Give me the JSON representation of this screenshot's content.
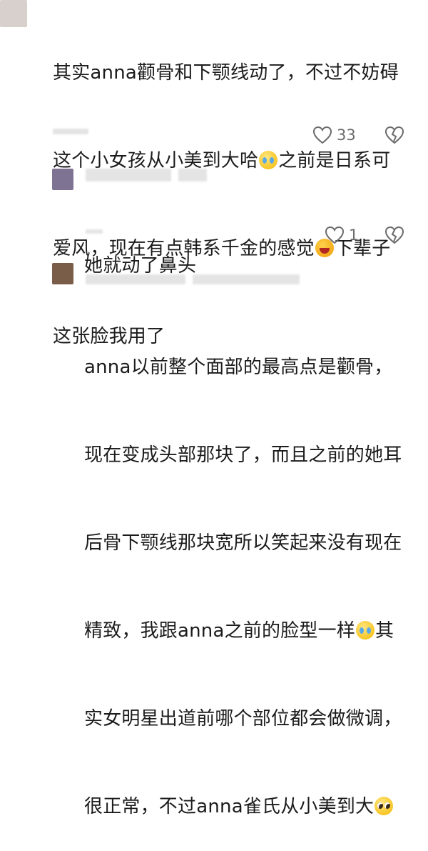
{
  "comments": [
    {
      "text_lines": [
        "其实anna颧骨和下颚线动了，不过不妨碍",
        "这个小女孩从小美到大哈",
        "之前是日系可",
        "爱风，现在有点韩系千金的感觉",
        "下辈子",
        "这张脸我用了"
      ],
      "emoji": [
        "crying-face",
        "laughing-crying-face"
      ],
      "likes": "33"
    },
    {
      "text_lines": [
        "她就动了鼻头"
      ],
      "likes": "1"
    },
    {
      "text_lines": [
        "anna以前整个面部的最高点是颧骨，",
        "现在变成头部那块了，而且之前的她耳",
        "后骨下颚线那块宽所以笑起来没有现在",
        "精致，我跟anna之前的脸型一样",
        "其",
        "实女明星出道前哪个部位都会做微调，",
        "很正常，不过anna雀氏从小美到大"
      ],
      "emoji": [
        "crying-face",
        "pleading-face"
      ]
    }
  ],
  "icons": {
    "like": "heart-outline-icon",
    "dislike": "broken-heart-icon"
  },
  "colors": {
    "text": "#1b1b1b",
    "meta": "#6b6b6b",
    "avatar1": "#d7d0cc",
    "avatar2": "#7f7394",
    "avatar3": "#7a5d48"
  }
}
